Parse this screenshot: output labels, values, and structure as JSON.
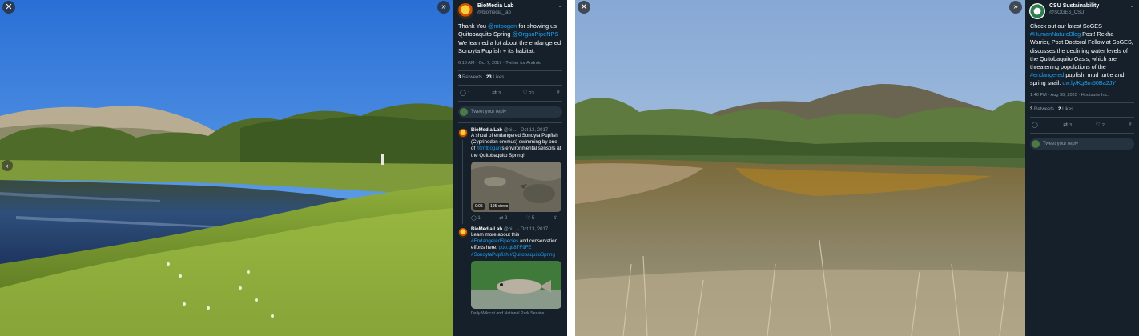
{
  "controls": {
    "close_glyph": "✕",
    "expand_glyph": "»",
    "prev_glyph": "‹",
    "menu_glyph": "⌄"
  },
  "left": {
    "author": {
      "name": "BioMedia Lab",
      "handle": "@biomedia_lab"
    },
    "tweet": {
      "t1": "Thank You ",
      "m1": "@mtbogan",
      "t2": " for showing us Quitobaquito Spring ",
      "m2": "@OrganPipeNPS",
      "t3": " ! We learned a lot about the endangered Sonoyta Pupfish + its habitat."
    },
    "meta": "6:18 AM · Oct 7, 2017 · Twitter for Android",
    "stats": {
      "retweets_count": "3",
      "retweets_label": "Retweets",
      "likes_count": "23",
      "likes_label": "Likes"
    },
    "actions": {
      "reply": "1",
      "retweet": "3",
      "like": "23"
    },
    "reply_placeholder": "Tweet your reply",
    "thread": [
      {
        "name": "BioMedia Lab",
        "handle_date": "@bi... · Oct 12, 2017",
        "text_a": "A shoal of endangered Sonoyta Pupfish (Cyprinodon eremus) swimming by one of ",
        "mention": "@mtbogan",
        "text_b": "'s environmental sensors at the Quitobaquito Spring!",
        "video_time": "0:05",
        "video_views": "195 views",
        "actions": {
          "reply": "1",
          "retweet": "2",
          "like": "5"
        }
      },
      {
        "name": "BioMedia Lab",
        "handle_date": "@bi... · Oct 13, 2017",
        "text_a": "Learn more about this ",
        "tag1": "#EndangeredSpecies",
        "text_b": " and conservation efforts here: ",
        "link": "goo.gl/8TF9FE",
        "tag2": "#SonoytaPupfish #QuitobaquitoSpring",
        "caption": "Daily Wildcat and National Park Service"
      }
    ]
  },
  "right": {
    "author": {
      "name": "CSU Sustainability",
      "handle": "@SOGES_CSU"
    },
    "tweet": {
      "t1": "Check out our latest SoGES ",
      "m1": "#HumanNatureBlog",
      "t2": " Post! Rekha Warrier, Post Doctoral Fellow at SoGES, discusses the declining water levels of the Quitobaquito Oasis, which are threatening populations of the ",
      "m2": "#endangered",
      "t3": " pupfish, mud turtle and spring snail. ",
      "m3": "ow.ly/KgBm50Ba2JY"
    },
    "meta": "1:40 PM · Aug 30, 2020 · Hootsuite Inc.",
    "stats": {
      "retweets_count": "3",
      "retweets_label": "Retweets",
      "likes_count": "2",
      "likes_label": "Likes"
    },
    "actions": {
      "reply": "",
      "retweet": "3",
      "like": "2"
    },
    "reply_placeholder": "Tweet your reply"
  },
  "colors": {
    "sidebar_bg": "#15202b",
    "link": "#1da1f2",
    "muted": "#8899a6"
  }
}
